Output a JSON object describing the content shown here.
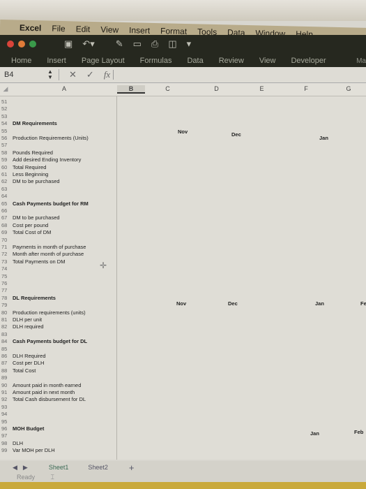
{
  "menubar": {
    "apple": "",
    "app": "Excel",
    "items": [
      "File",
      "Edit",
      "View",
      "Insert",
      "Format",
      "Tools",
      "Data",
      "Window",
      "Help"
    ]
  },
  "toolbar": {
    "icons": [
      "save-icon",
      "undo-icon",
      "edit-icon",
      "table-icon",
      "print-icon",
      "sidebar-icon",
      "more-icon"
    ]
  },
  "ribbon": {
    "tabs": [
      "Home",
      "Insert",
      "Page Layout",
      "Formulas",
      "Data",
      "Review",
      "View",
      "Developer"
    ],
    "right_label": "Ma"
  },
  "formula_bar": {
    "name_box": "B4",
    "cancel": "✕",
    "confirm": "✓",
    "fx": "fx",
    "value": ""
  },
  "columns": [
    "A",
    "B",
    "C",
    "D",
    "E",
    "F",
    "G"
  ],
  "rows": [
    {
      "n": "51",
      "label": "",
      "bold": false
    },
    {
      "n": "52",
      "label": "",
      "bold": false
    },
    {
      "n": "53",
      "label": "",
      "bold": false
    },
    {
      "n": "54",
      "label": "DM Requirements",
      "bold": true
    },
    {
      "n": "55",
      "label": "",
      "bold": false
    },
    {
      "n": "56",
      "label": "Production Requirements (Units)",
      "bold": false
    },
    {
      "n": "57",
      "label": "",
      "bold": false
    },
    {
      "n": "58",
      "label": "Pounds Required",
      "bold": false
    },
    {
      "n": "59",
      "label": "Add desired Ending Inventory",
      "bold": false
    },
    {
      "n": "60",
      "label": "Total Required",
      "bold": false
    },
    {
      "n": "61",
      "label": "Less Beginning",
      "bold": false
    },
    {
      "n": "62",
      "label": "DM to be purchased",
      "bold": false
    },
    {
      "n": "63",
      "label": "",
      "bold": false
    },
    {
      "n": "64",
      "label": "",
      "bold": false
    },
    {
      "n": "65",
      "label": "Cash Payments budget for RM",
      "bold": true
    },
    {
      "n": "66",
      "label": "",
      "bold": false
    },
    {
      "n": "67",
      "label": "DM to be purchased",
      "bold": false
    },
    {
      "n": "68",
      "label": "Cost per  pound",
      "bold": false
    },
    {
      "n": "69",
      "label": "Total Cost of DM",
      "bold": false
    },
    {
      "n": "70",
      "label": "",
      "bold": false
    },
    {
      "n": "71",
      "label": "Payments in month of purchase",
      "bold": false
    },
    {
      "n": "72",
      "label": "Month after month of purchase",
      "bold": false
    },
    {
      "n": "73",
      "label": "Total Payments on DM",
      "bold": false
    },
    {
      "n": "74",
      "label": "",
      "bold": false
    },
    {
      "n": "75",
      "label": "",
      "bold": false
    },
    {
      "n": "76",
      "label": "",
      "bold": false
    },
    {
      "n": "77",
      "label": "",
      "bold": false
    },
    {
      "n": "78",
      "label": "DL Requirements",
      "bold": true
    },
    {
      "n": "79",
      "label": "",
      "bold": false
    },
    {
      "n": "80",
      "label": "Production requirements (units)",
      "bold": false
    },
    {
      "n": "81",
      "label": "DLH per unit",
      "bold": false
    },
    {
      "n": "82",
      "label": "DLH required",
      "bold": false
    },
    {
      "n": "83",
      "label": "",
      "bold": false
    },
    {
      "n": "84",
      "label": "Cash Payments budget for DL",
      "bold": true
    },
    {
      "n": "85",
      "label": "",
      "bold": false
    },
    {
      "n": "86",
      "label": "DLH Required",
      "bold": false
    },
    {
      "n": "87",
      "label": "Cost per DLH",
      "bold": false
    },
    {
      "n": "88",
      "label": "Total Cost",
      "bold": false
    },
    {
      "n": "89",
      "label": "",
      "bold": false
    },
    {
      "n": "90",
      "label": "Amount paid in month earned",
      "bold": false
    },
    {
      "n": "91",
      "label": "Amount paid in next month",
      "bold": false
    },
    {
      "n": "92",
      "label": "Total Cash disbursement for DL",
      "bold": false
    },
    {
      "n": "93",
      "label": "",
      "bold": false
    },
    {
      "n": "94",
      "label": "",
      "bold": false
    },
    {
      "n": "95",
      "label": "",
      "bold": false
    },
    {
      "n": "96",
      "label": "MOH Budget",
      "bold": true
    },
    {
      "n": "97",
      "label": "",
      "bold": false
    },
    {
      "n": "98",
      "label": "DLH",
      "bold": false
    },
    {
      "n": "99",
      "label": "Var MOH per DLH",
      "bold": false
    }
  ],
  "month_headers": {
    "dm": [
      "Nov",
      "Dec",
      "Jan"
    ],
    "dl": [
      "Nov",
      "Dec",
      "Jan",
      "Fe"
    ],
    "moh": [
      "Jan",
      "Feb"
    ]
  },
  "sheet_tabs": [
    "Sheet1",
    "Sheet2"
  ],
  "add_sheet": "+",
  "status": "Ready"
}
